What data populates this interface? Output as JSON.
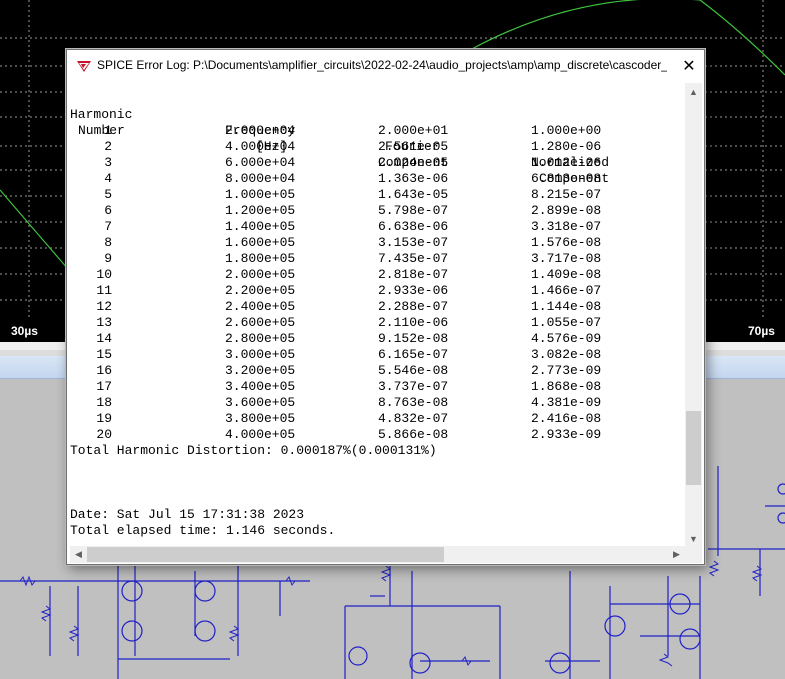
{
  "plot": {
    "x_labels": [
      "30µs",
      "70µs"
    ]
  },
  "dialog": {
    "title": "SPICE Error Log: P:\\Documents\\amplifier_circuits\\2022-02-24\\audio_projects\\amp\\amp_discrete\\cascoder_...",
    "close_glyph": "✕",
    "headers": {
      "col1": [
        "Harmonic",
        "Number"
      ],
      "col2": [
        "Frequency",
        "[Hz]"
      ],
      "col3": [
        "Fourier",
        "Component"
      ],
      "col4": [
        "Normalized",
        "Component"
      ]
    },
    "rows": [
      {
        "n": "1",
        "freq": "2.000e+04",
        "fourier": "2.000e+01",
        "norm": "1.000e+00"
      },
      {
        "n": "2",
        "freq": "4.000e+04",
        "fourier": "2.561e-05",
        "norm": "1.280e-06"
      },
      {
        "n": "3",
        "freq": "6.000e+04",
        "fourier": "2.024e-05",
        "norm": "1.012e-06"
      },
      {
        "n": "4",
        "freq": "8.000e+04",
        "fourier": "1.363e-06",
        "norm": "6.813e-08"
      },
      {
        "n": "5",
        "freq": "1.000e+05",
        "fourier": "1.643e-05",
        "norm": "8.215e-07"
      },
      {
        "n": "6",
        "freq": "1.200e+05",
        "fourier": "5.798e-07",
        "norm": "2.899e-08"
      },
      {
        "n": "7",
        "freq": "1.400e+05",
        "fourier": "6.638e-06",
        "norm": "3.318e-07"
      },
      {
        "n": "8",
        "freq": "1.600e+05",
        "fourier": "3.153e-07",
        "norm": "1.576e-08"
      },
      {
        "n": "9",
        "freq": "1.800e+05",
        "fourier": "7.435e-07",
        "norm": "3.717e-08"
      },
      {
        "n": "10",
        "freq": "2.000e+05",
        "fourier": "2.818e-07",
        "norm": "1.409e-08"
      },
      {
        "n": "11",
        "freq": "2.200e+05",
        "fourier": "2.933e-06",
        "norm": "1.466e-07"
      },
      {
        "n": "12",
        "freq": "2.400e+05",
        "fourier": "2.288e-07",
        "norm": "1.144e-08"
      },
      {
        "n": "13",
        "freq": "2.600e+05",
        "fourier": "2.110e-06",
        "norm": "1.055e-07"
      },
      {
        "n": "14",
        "freq": "2.800e+05",
        "fourier": "9.152e-08",
        "norm": "4.576e-09"
      },
      {
        "n": "15",
        "freq": "3.000e+05",
        "fourier": "6.165e-07",
        "norm": "3.082e-08"
      },
      {
        "n": "16",
        "freq": "3.200e+05",
        "fourier": "5.546e-08",
        "norm": "2.773e-09"
      },
      {
        "n": "17",
        "freq": "3.400e+05",
        "fourier": "3.737e-07",
        "norm": "1.868e-08"
      },
      {
        "n": "18",
        "freq": "3.600e+05",
        "fourier": "8.763e-08",
        "norm": "4.381e-09"
      },
      {
        "n": "19",
        "freq": "3.800e+05",
        "fourier": "4.832e-07",
        "norm": "2.416e-08"
      },
      {
        "n": "20",
        "freq": "4.000e+05",
        "fourier": "5.866e-08",
        "norm": "2.933e-09"
      }
    ],
    "thd_line": "Total Harmonic Distortion: 0.000187%(0.000131%)",
    "date_line": "Date: Sat Jul 15 17:31:38 2023",
    "elapsed_line": "Total elapsed time: 1.146 seconds."
  },
  "scrollbars": {
    "up_glyph": "▲",
    "down_glyph": "▼",
    "left_glyph": "◀",
    "right_glyph": "▶"
  },
  "icons": {
    "title_icon": "ltspice-app-icon"
  }
}
